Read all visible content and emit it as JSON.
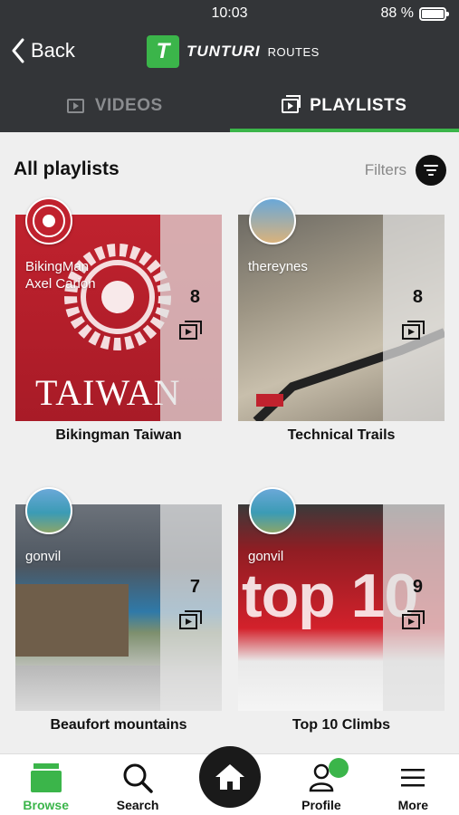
{
  "status": {
    "time": "10:03",
    "battery": "88 %"
  },
  "header": {
    "back_label": "Back",
    "brand_name": "TUNTURI",
    "brand_suffix": "ROUTES"
  },
  "tabs": [
    {
      "label": "VIDEOS",
      "icon": "play-icon",
      "active": false
    },
    {
      "label": "PLAYLISTS",
      "icon": "playlist-icon",
      "active": true
    }
  ],
  "section": {
    "title": "All playlists",
    "filters_label": "Filters"
  },
  "playlists": [
    {
      "title": "Bikingman Taiwan",
      "user_line1": "BikingMan",
      "user_line2": "Axel Carion",
      "count": "8",
      "cover_text": "TAIWAN"
    },
    {
      "title": "Technical Trails",
      "user_line1": "thereynes",
      "user_line2": "",
      "count": "8",
      "cover_text": ""
    },
    {
      "title": "Beaufort mountains",
      "user_line1": "gonvil",
      "user_line2": "",
      "count": "7",
      "cover_text": ""
    },
    {
      "title": "Top 10 Climbs",
      "user_line1": "gonvil",
      "user_line2": "",
      "count": "9",
      "cover_text": "top 10"
    }
  ],
  "bottom_nav": [
    {
      "label": "Browse",
      "icon": "browse-icon",
      "active": true
    },
    {
      "label": "Search",
      "icon": "search-icon",
      "active": false
    },
    {
      "label": "",
      "icon": "home-icon",
      "active": false
    },
    {
      "label": "Profile",
      "icon": "profile-icon",
      "active": false
    },
    {
      "label": "More",
      "icon": "menu-icon",
      "active": false
    }
  ],
  "colors": {
    "accent": "#3bb54a",
    "header_bg": "#333538",
    "content_bg": "#efefef"
  }
}
